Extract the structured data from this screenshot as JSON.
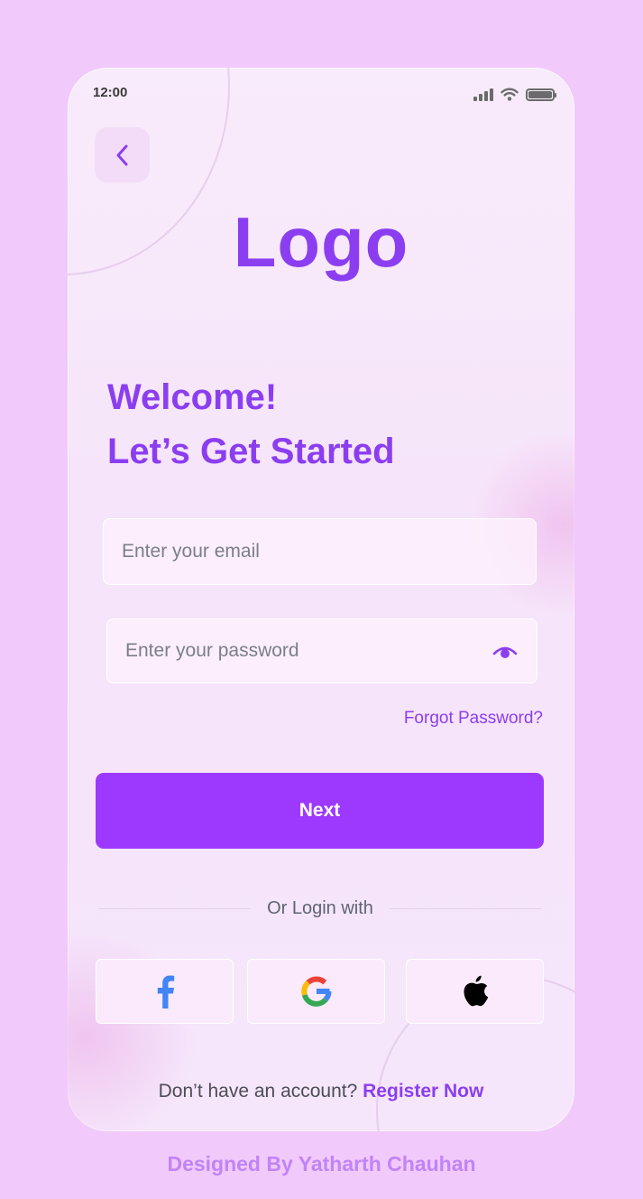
{
  "status_bar": {
    "time": "12:00"
  },
  "icons": {
    "back": "chevron-left-icon",
    "signal": "signal-icon",
    "wifi": "wifi-icon",
    "battery": "battery-icon",
    "show_password": "eye-icon",
    "facebook": "facebook-icon",
    "google": "google-icon",
    "apple": "apple-icon"
  },
  "logo": "Logo",
  "heading": {
    "line1": "Welcome!",
    "line2": "Let’s Get Started"
  },
  "form": {
    "email_placeholder": "Enter your email",
    "password_placeholder": "Enter your password",
    "forgot_password": "Forgot Password?",
    "next_label": "Next"
  },
  "social": {
    "divider_text": "Or Login with"
  },
  "register": {
    "prompt": "Don’t have an account?",
    "link": "Register Now"
  },
  "credit": "Designed By Yatharth Chauhan",
  "colors": {
    "page_background": "#f1c9fb",
    "accent": "#8b3ef0",
    "button": "#9d39ff",
    "facebook": "#4285f4"
  }
}
